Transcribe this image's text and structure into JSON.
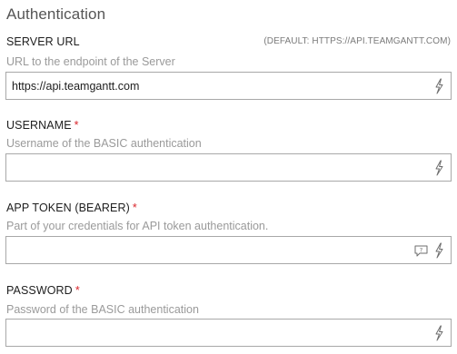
{
  "section": {
    "title": "Authentication"
  },
  "fields": {
    "server_url": {
      "label": "SERVER URL",
      "default_hint": "(DEFAULT: HTTPS://API.TEAMGANTT.COM)",
      "description": "URL to the endpoint of the Server",
      "value": "https://api.teamgantt.com",
      "icon": "lightning-icon"
    },
    "username": {
      "label": "USERNAME",
      "required_mark": "*",
      "description": "Username of the BASIC authentication",
      "value": "",
      "icon": "lightning-icon"
    },
    "app_token": {
      "label": "APP TOKEN (BEARER)",
      "required_mark": "*",
      "description": "Part of your credentials for API token authentication.",
      "value": "",
      "icons": [
        "help-icon",
        "lightning-icon"
      ]
    },
    "password": {
      "label": "PASSWORD",
      "required_mark": "*",
      "description": "Password of the BASIC authentication",
      "value": "",
      "icon": "lightning-icon"
    }
  },
  "colors": {
    "required": "#d9262c",
    "border": "#a8a8a8",
    "description": "#9a9a9a"
  }
}
